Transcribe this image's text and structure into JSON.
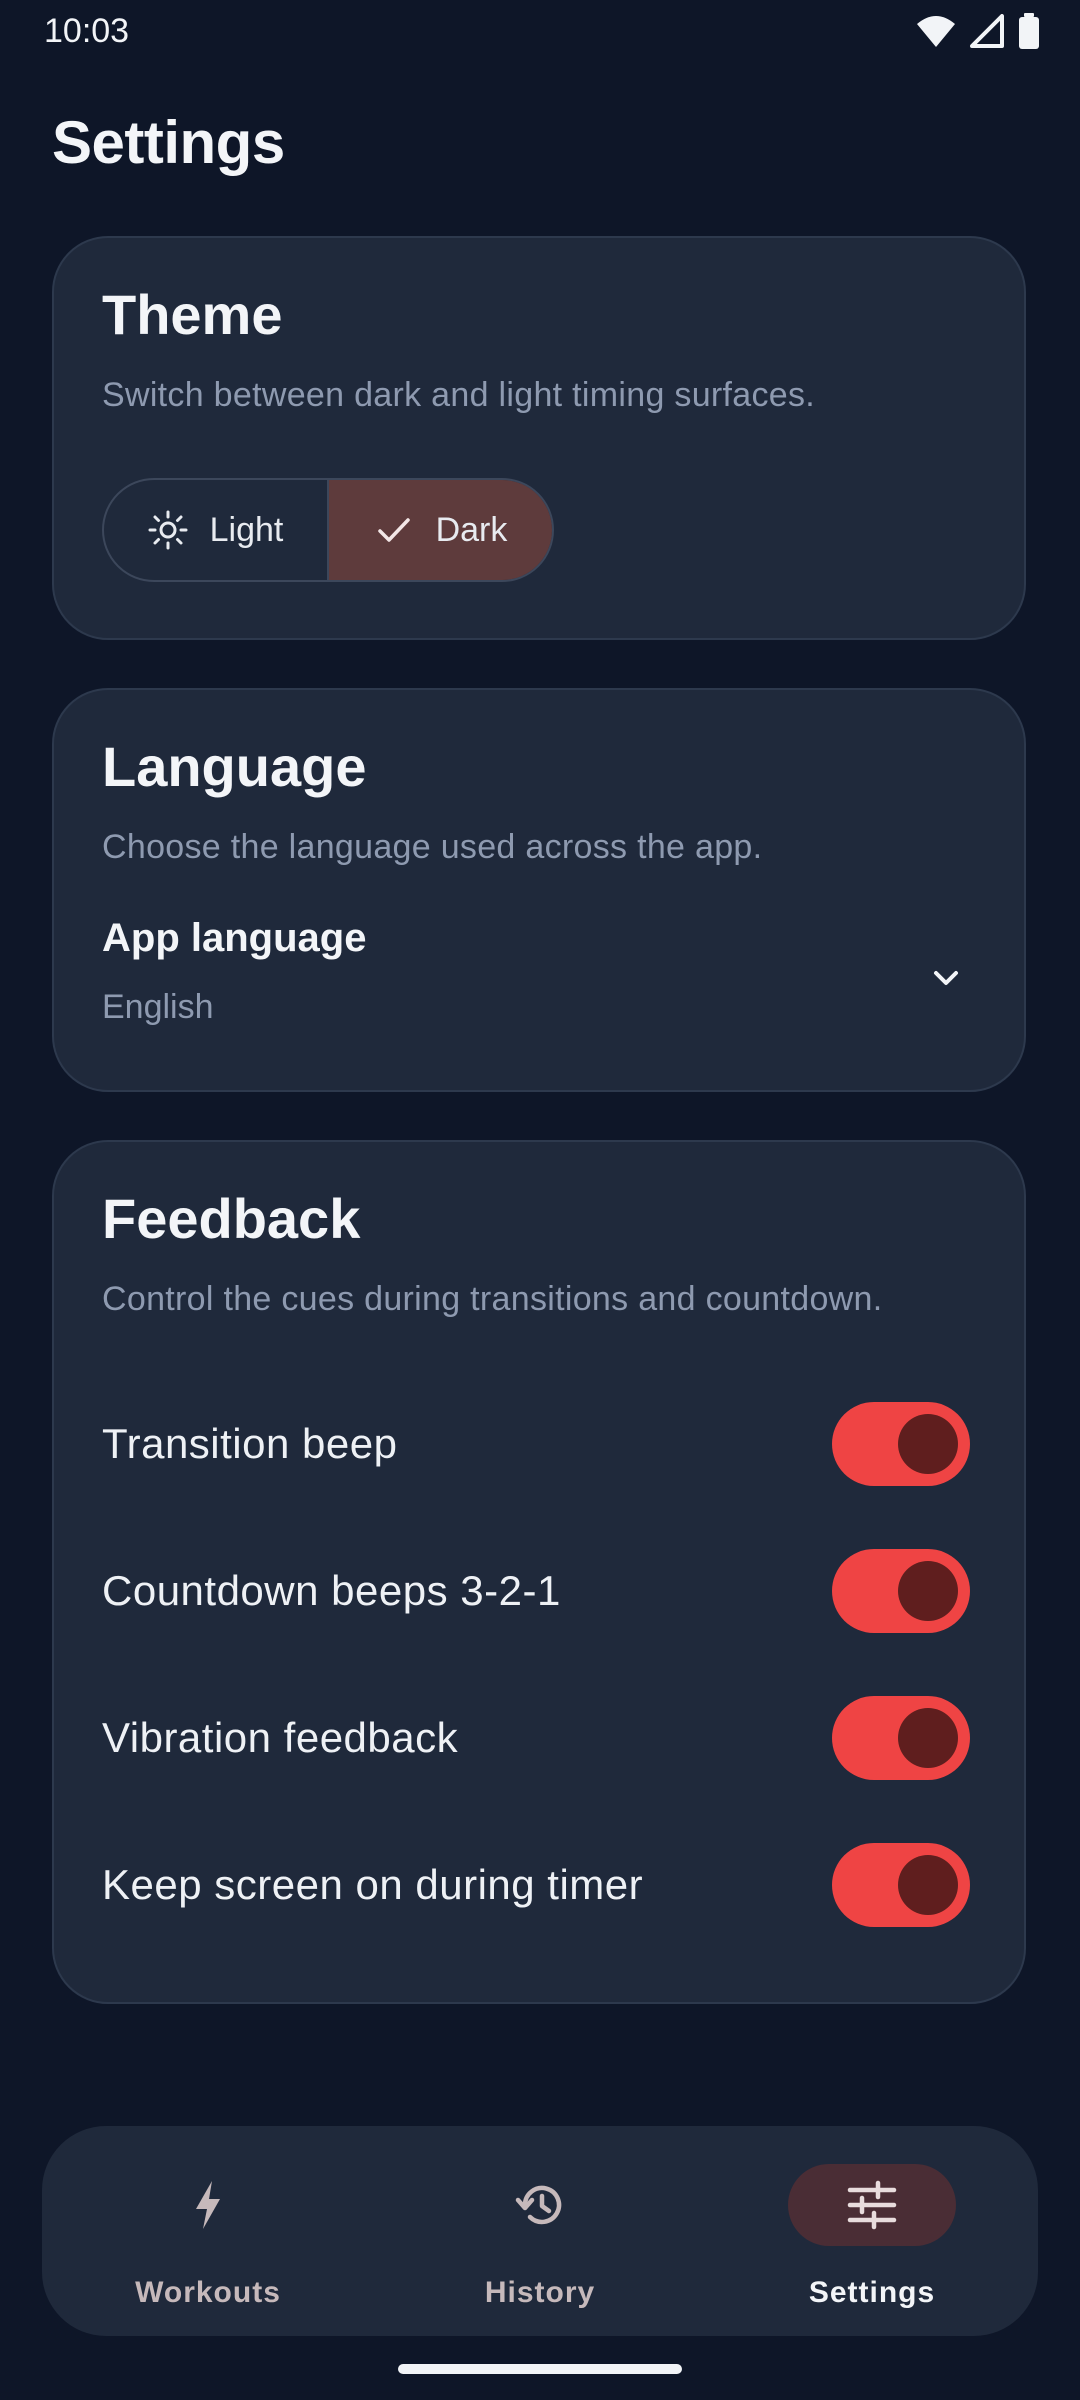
{
  "status_bar": {
    "time": "10:03"
  },
  "page": {
    "title": "Settings"
  },
  "theme": {
    "title": "Theme",
    "description": "Switch between dark and light timing surfaces.",
    "options": [
      {
        "label": "Light",
        "icon": "sun-icon",
        "selected": false
      },
      {
        "label": "Dark",
        "icon": "check-icon",
        "selected": true
      }
    ]
  },
  "language": {
    "title": "Language",
    "description": "Choose the language used across the app.",
    "field_label": "App language",
    "value": "English"
  },
  "feedback": {
    "title": "Feedback",
    "description": "Control the cues during transitions and countdown.",
    "toggles": [
      {
        "label": "Transition beep",
        "on": true
      },
      {
        "label": "Countdown beeps 3-2-1",
        "on": true
      },
      {
        "label": "Vibration feedback",
        "on": true
      },
      {
        "label": "Keep screen on during timer",
        "on": true
      }
    ]
  },
  "nav": {
    "items": [
      {
        "label": "Workouts",
        "icon": "bolt-icon",
        "active": false
      },
      {
        "label": "History",
        "icon": "history-icon",
        "active": false
      },
      {
        "label": "Settings",
        "icon": "sliders-icon",
        "active": true
      }
    ]
  },
  "colors": {
    "background": "#0e1628",
    "card": "#1f293b",
    "accent": "#ef4444",
    "selected_segment": "#5e3b3c"
  }
}
